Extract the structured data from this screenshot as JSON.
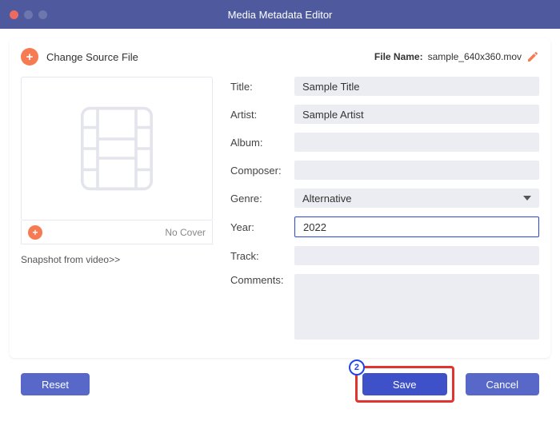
{
  "window": {
    "title": "Media Metadata Editor"
  },
  "header": {
    "change_source": "Change Source File",
    "file_label": "File Name:",
    "file_name": "sample_640x360.mov"
  },
  "cover": {
    "no_cover": "No Cover",
    "snapshot_link": "Snapshot from video>>"
  },
  "labels": {
    "title": "Title:",
    "artist": "Artist:",
    "album": "Album:",
    "composer": "Composer:",
    "genre": "Genre:",
    "year": "Year:",
    "track": "Track:",
    "comments": "Comments:"
  },
  "values": {
    "title": "Sample Title",
    "artist": "Sample Artist",
    "album": "",
    "composer": "",
    "genre": "Alternative",
    "year": "2022",
    "track": "",
    "comments": ""
  },
  "buttons": {
    "reset": "Reset",
    "save": "Save",
    "cancel": "Cancel"
  },
  "annotation": {
    "step": "2"
  }
}
